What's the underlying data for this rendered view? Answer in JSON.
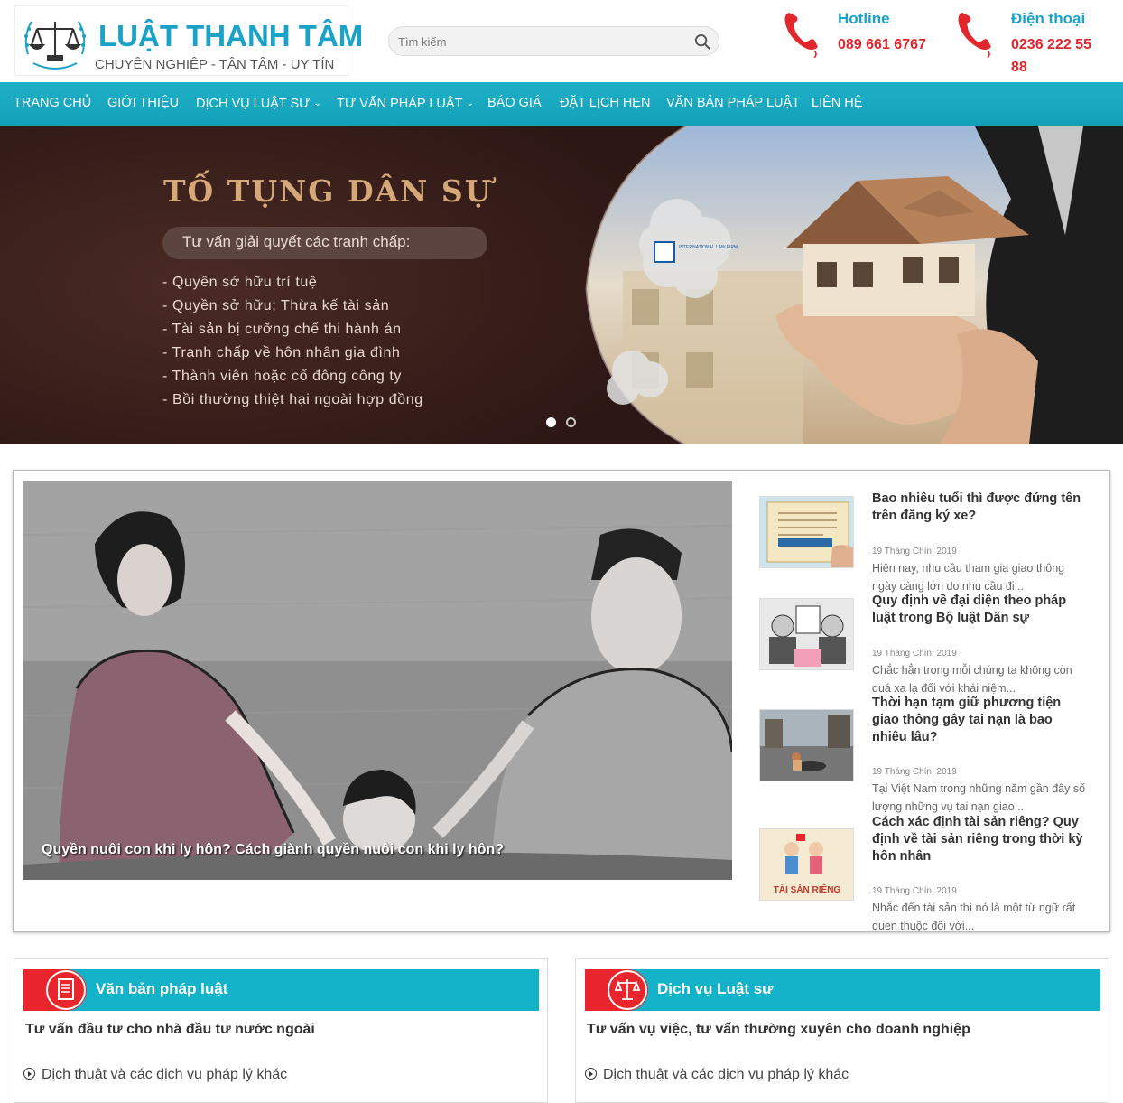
{
  "header": {
    "logo": {
      "name": "LUẬT THANH TÂM",
      "tagline": "CHUYÊN NGHIỆP - TẬN TÂM - UY TÍN"
    },
    "search": {
      "placeholder": "Tìm kiếm"
    },
    "hotline": {
      "label": "Hotline",
      "number": "089 661 6767"
    },
    "phone": {
      "label": "Điện thoại",
      "number_line1": "0236 222 55",
      "number_line2": "88"
    }
  },
  "nav": {
    "items": [
      {
        "label": "TRANG CHỦ"
      },
      {
        "label": "GIỚI THIỆU"
      },
      {
        "label": "DỊCH VỤ LUẬT SƯ"
      },
      {
        "label": "TƯ VẤN PHÁP LUẬT"
      },
      {
        "label": "BÁO GIÁ"
      },
      {
        "label": "ĐẶT LỊCH HẸN"
      },
      {
        "label": "VĂN BẢN PHÁP LUẬT"
      },
      {
        "label": "LIÊN HỆ"
      }
    ]
  },
  "banner": {
    "title": "TỐ TỤNG DÂN SỰ",
    "subtitle": "Tư vấn giải quyết các tranh chấp:",
    "items": [
      "- Quyền sở hữu trí tuệ",
      "- Quyền sở hữu; Thừa kế tài sản",
      "- Tài sản bị cưỡng chế thi hành án",
      "- Tranh chấp về hôn nhân gia đình",
      "- Thành viên hoặc cổ đông công ty",
      "- Bồi thường thiệt hại ngoài hợp đồng"
    ],
    "slides_total": 2,
    "active_slide": 1
  },
  "featured": {
    "hero_caption": "Quyền nuôi con khi ly hôn? Cách giành quyền nuôi con khi ly hôn?",
    "posts": [
      {
        "title": "Bao nhiêu tuổi thì được đứng tên trên đăng ký xe?",
        "date": "19 Tháng Chín, 2019",
        "excerpt": "Hiện nay, nhu cầu tham gia giao thông ngày càng lớn do nhu cầu đi..."
      },
      {
        "title": "Quy định về đại diện theo pháp luật trong Bộ luật Dân sự",
        "date": "19 Tháng Chín, 2019",
        "excerpt": "Chắc hẳn trong mỗi chúng ta không còn quá xa lạ đối với khái niệm..."
      },
      {
        "title": "Thời hạn tạm giữ phương tiện giao thông gây tai nạn là bao nhiêu lâu?",
        "date": "19 Tháng Chín, 2019",
        "excerpt": "Tại Việt Nam trong những năm gần đây số lượng những vụ tai nạn giao..."
      },
      {
        "title": "Cách xác định tài sản riêng? Quy định về tài sản riêng trong thời kỳ hôn nhân",
        "date": "19 Tháng Chín, 2019",
        "excerpt": "Nhắc đến tài sản thì nó là một từ ngữ rất quen thuộc đối với..."
      }
    ],
    "thumb4_text": "TÀI SẢN RIÊNG"
  },
  "boxes": [
    {
      "title": "Văn bản pháp luật",
      "subtitle": "Tư vấn đầu tư cho nhà đầu tư nước ngoài",
      "link": "Dịch thuật và các dịch vụ pháp lý khác"
    },
    {
      "title": "Dịch vụ Luật sư",
      "subtitle": "Tư vấn vụ việc, tư vấn thường xuyên cho doanh nghiệp",
      "link": "Dịch thuật và các dịch vụ pháp lý khác"
    }
  ],
  "colors": {
    "accent": "#1aa3c8",
    "nav": "#13a8c0",
    "red": "#e1262d",
    "banner_bg": "#3a1f1b"
  }
}
